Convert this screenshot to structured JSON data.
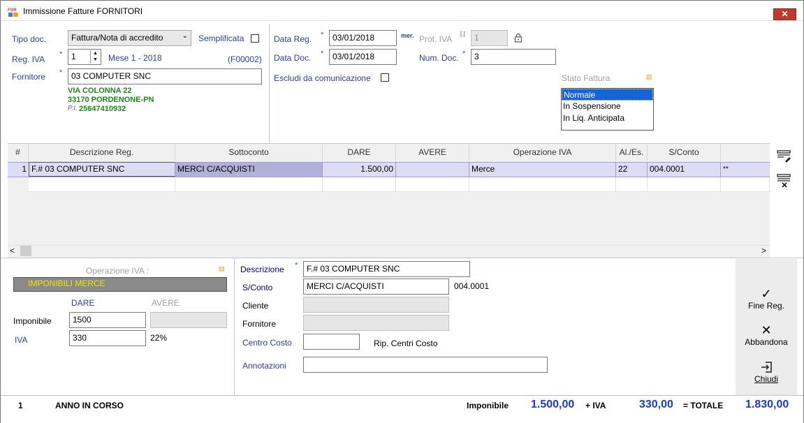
{
  "window": {
    "title": "Immissione Fatture FORNITORI",
    "icon_text": "FOR"
  },
  "header": {
    "tipo_doc_label": "Tipo doc.",
    "tipo_doc_value": "Fattura/Nota di accredito",
    "semplificata_label": "Semplificata",
    "reg_iva_label": "Reg. IVA",
    "reg_iva_value": "1",
    "mese": "Mese 1 - 2018",
    "code": "(F00002)",
    "fornitore_label": "Fornitore",
    "fornitore_value": "03 COMPUTER SNC",
    "address1": "VIA COLONNA 22",
    "address2": "33170 PORDENONE-PN",
    "piva_label": "P.I.",
    "piva_value": "25647410932",
    "data_reg_label": "Data Reg.",
    "data_reg_value": "03/01/2018",
    "mer_label": "mer.",
    "prot_iva_label": "Prot. IVA",
    "prot_iva_value": "1",
    "data_doc_label": "Data Doc.",
    "data_doc_value": "03/01/2018",
    "num_doc_label": "Num. Doc.",
    "num_doc_value": "3",
    "escludi_label": "Escludi da comunicazione",
    "stato_label": "Stato Fattura",
    "stato_options": [
      "Normale",
      "In Sospensione",
      "In Liq. Anticipata"
    ]
  },
  "grid": {
    "columns": [
      "#",
      "Descrizione Reg.",
      "Sottoconto",
      "DARE",
      "AVERE",
      "Operazione IVA",
      "Al./Es.",
      "S/Conto"
    ],
    "rows": [
      {
        "n": "1",
        "descrizione": "F.# 03 COMPUTER SNC",
        "sottoconto": "MERCI C/ACQUISTI",
        "dare": "1.500,00",
        "avere": "",
        "operazione": "Merce",
        "aliquota": "22",
        "sconto": "004.0001",
        "flag": "**"
      }
    ]
  },
  "lower": {
    "operazione_label": "Operazione IVA :",
    "operazione_value": "IMPONIBILI MERCE",
    "dare_label": "DARE",
    "avere_label": "AVERE",
    "imponibile_label": "Imponibile",
    "imponibile_value": "1500",
    "iva_label": "IVA",
    "iva_value": "330",
    "iva_pct": "22%",
    "descrizione_label": "Descrizione",
    "descrizione_value": "F.# 03 COMPUTER SNC",
    "sconto_label": "S/Conto",
    "sconto_value": "MERCI C/ACQUISTI",
    "sconto_code": "004.0001",
    "cliente_label": "Cliente",
    "fornitore_label": "Fornitore",
    "centro_costo_label": "Centro Costo",
    "rip_label": "Rip. Centri Costo",
    "annotazioni_label": "Annotazioni"
  },
  "actions": {
    "fine": "Fine Reg.",
    "abbandona": "Abbandona",
    "chiudi": "Chiudi"
  },
  "footer": {
    "num": "1",
    "anno": "ANNO IN CORSO",
    "imponibile_label": "Imponibile",
    "imponibile_value": "1.500,00",
    "iva_label": "+ IVA",
    "iva_value": "330,00",
    "totale_label": "= TOTALE",
    "totale_value": "1.830,00"
  }
}
